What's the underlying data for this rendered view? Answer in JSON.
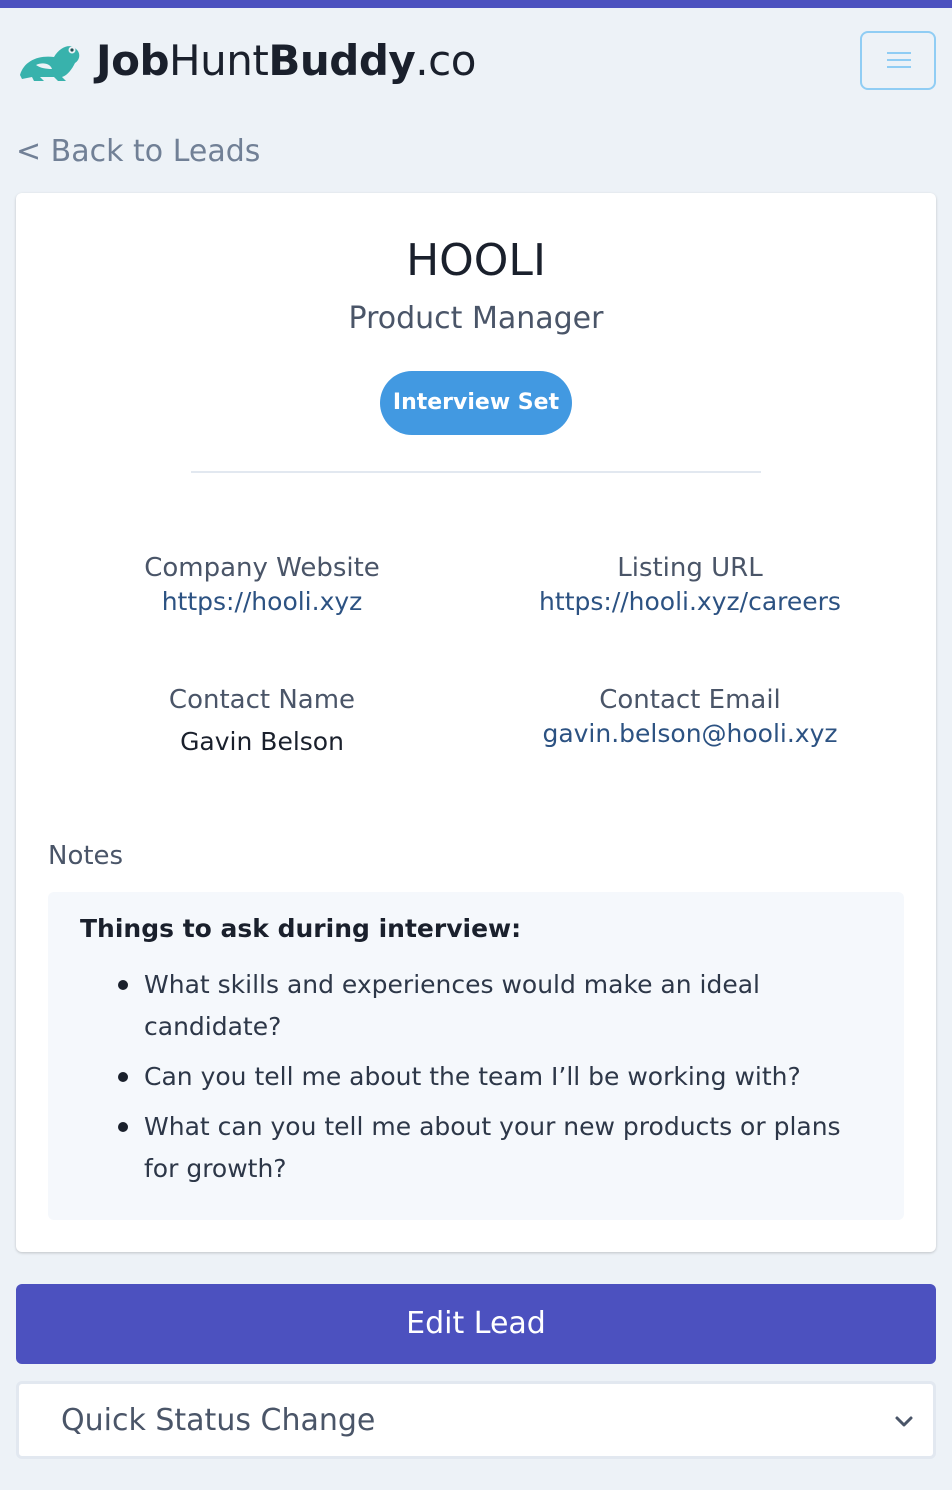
{
  "header": {
    "logo_bold_1": "Job",
    "logo_light_1": "Hunt",
    "logo_bold_2": "Buddy",
    "logo_light_2": ".co",
    "logo_icon": "frog-icon",
    "menu_icon": "hamburger-menu-icon"
  },
  "nav": {
    "back_link": "< Back to Leads"
  },
  "lead": {
    "company": "HOOLI",
    "role": "Product Manager",
    "status": "Interview Set",
    "fields": {
      "company_website_label": "Company Website",
      "company_website_value": "https://hooli.xyz",
      "listing_url_label": "Listing URL",
      "listing_url_value": "https://hooli.xyz/careers",
      "contact_name_label": "Contact Name",
      "contact_name_value": "Gavin Belson",
      "contact_email_label": "Contact Email",
      "contact_email_value": "gavin.belson@hooli.xyz"
    },
    "notes": {
      "label": "Notes",
      "heading": "Things to ask during interview:",
      "items": [
        "What skills and experiences would make an ideal candidate?",
        "Can you tell me about the team I’ll be working with?",
        "What can you tell me about your new products or plans for growth?"
      ]
    }
  },
  "actions": {
    "edit_label": "Edit Lead",
    "status_select_label": "Quick Status Change",
    "status_select_icon": "chevron-down-icon"
  },
  "colors": {
    "accent": "#4c51bf",
    "status_badge": "#4299e1",
    "logo_green": "#38b2ac",
    "link": "#2c5282",
    "background": "#edf2f7"
  }
}
